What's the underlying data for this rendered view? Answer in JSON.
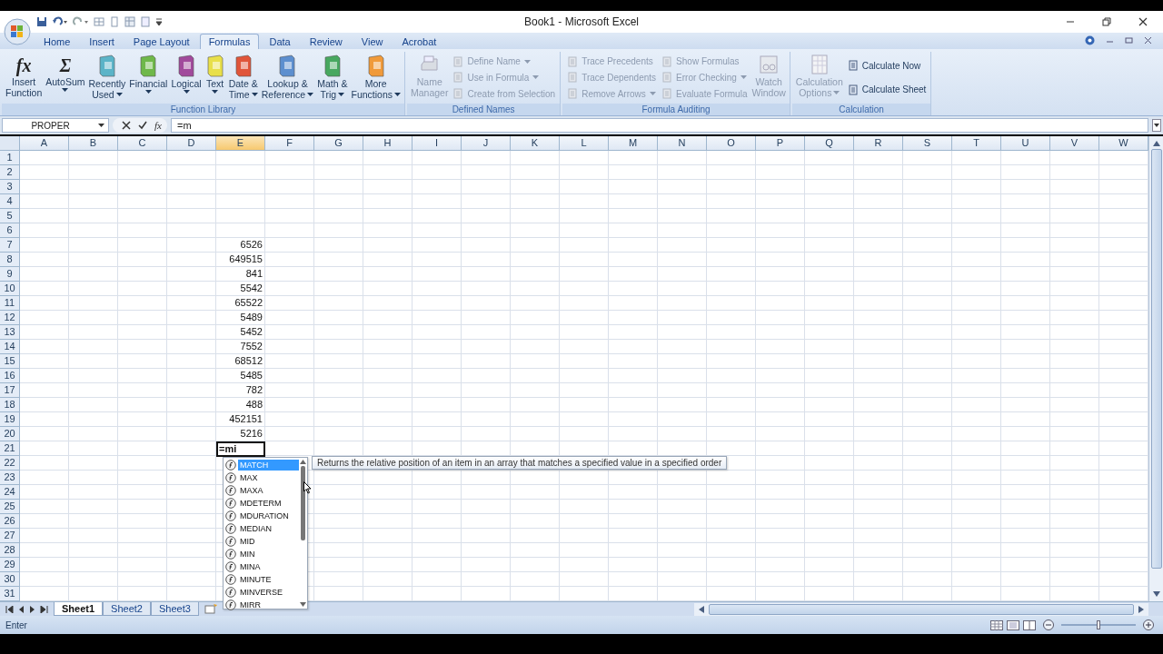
{
  "window": {
    "title": "Book1 - Microsoft Excel"
  },
  "tabs": [
    {
      "label": "Home",
      "selected": false
    },
    {
      "label": "Insert",
      "selected": false
    },
    {
      "label": "Page Layout",
      "selected": false
    },
    {
      "label": "Formulas",
      "selected": true
    },
    {
      "label": "Data",
      "selected": false
    },
    {
      "label": "Review",
      "selected": false
    },
    {
      "label": "View",
      "selected": false
    },
    {
      "label": "Acrobat",
      "selected": false
    }
  ],
  "ribbon": {
    "groups": [
      {
        "title": "Function Library",
        "items": [
          {
            "kind": "large",
            "label": [
              "Insert",
              "Function"
            ],
            "glyph": "fx",
            "dropdown": false,
            "disabled": false
          },
          {
            "kind": "large",
            "label": [
              "AutoSum"
            ],
            "glyph": "Σ",
            "dropdown": true,
            "disabled": false
          },
          {
            "kind": "large",
            "label": [
              "Recently",
              "Used"
            ],
            "color": "#5bb4c8",
            "dropdown": true,
            "disabled": false
          },
          {
            "kind": "large",
            "label": [
              "Financial"
            ],
            "color": "#6fb84a",
            "dropdown": true,
            "disabled": false
          },
          {
            "kind": "large",
            "label": [
              "Logical"
            ],
            "color": "#a14a9c",
            "dropdown": true,
            "disabled": false
          },
          {
            "kind": "large",
            "label": [
              "Text"
            ],
            "color": "#e8df4a",
            "dropdown": true,
            "disabled": false
          },
          {
            "kind": "large",
            "label": [
              "Date &",
              "Time"
            ],
            "color": "#e0553a",
            "dropdown": true,
            "disabled": false
          },
          {
            "kind": "large",
            "label": [
              "Lookup &",
              "Reference"
            ],
            "color": "#5d8fcf",
            "dropdown": true,
            "disabled": false
          },
          {
            "kind": "large",
            "label": [
              "Math &",
              "Trig"
            ],
            "color": "#48a860",
            "dropdown": true,
            "disabled": false
          },
          {
            "kind": "large",
            "label": [
              "More",
              "Functions"
            ],
            "color": "#f09a3a",
            "dropdown": true,
            "disabled": false
          }
        ]
      },
      {
        "title": "Defined Names",
        "items": [
          {
            "kind": "large",
            "label": [
              "Name",
              "Manager"
            ],
            "dropdown": false,
            "disabled": true
          },
          {
            "kind": "small",
            "label": "Define Name",
            "dropdown": true,
            "disabled": true
          },
          {
            "kind": "small",
            "label": "Use in Formula",
            "dropdown": true,
            "disabled": true
          },
          {
            "kind": "small",
            "label": "Create from Selection",
            "dropdown": false,
            "disabled": true
          }
        ]
      },
      {
        "title": "Formula Auditing",
        "items": [
          {
            "kind": "small",
            "label": "Trace Precedents",
            "dropdown": false,
            "disabled": true
          },
          {
            "kind": "small",
            "label": "Trace Dependents",
            "dropdown": false,
            "disabled": true
          },
          {
            "kind": "small",
            "label": "Remove Arrows",
            "dropdown": true,
            "disabled": true
          },
          {
            "kind": "small",
            "label": "Show Formulas",
            "dropdown": false,
            "disabled": true
          },
          {
            "kind": "small",
            "label": "Error Checking",
            "dropdown": true,
            "disabled": true
          },
          {
            "kind": "small",
            "label": "Evaluate Formula",
            "dropdown": false,
            "disabled": true
          },
          {
            "kind": "large",
            "label": [
              "Watch",
              "Window"
            ],
            "dropdown": false,
            "disabled": true
          }
        ]
      },
      {
        "title": "Calculation",
        "items": [
          {
            "kind": "large",
            "label": [
              "Calculation",
              "Options"
            ],
            "dropdown": true,
            "disabled": true
          },
          {
            "kind": "small",
            "label": "Calculate Now",
            "dropdown": false,
            "disabled": false
          },
          {
            "kind": "small",
            "label": "Calculate Sheet",
            "dropdown": false,
            "disabled": false
          }
        ]
      }
    ]
  },
  "formula_bar": {
    "name_box": "PROPER",
    "function_glyph": "fx",
    "formula": "=m"
  },
  "columns": [
    {
      "label": "A",
      "selected": false
    },
    {
      "label": "B",
      "selected": false
    },
    {
      "label": "C",
      "selected": false
    },
    {
      "label": "D",
      "selected": false
    },
    {
      "label": "E",
      "selected": true
    },
    {
      "label": "F",
      "selected": false
    },
    {
      "label": "G",
      "selected": false
    },
    {
      "label": "H",
      "selected": false
    },
    {
      "label": "I",
      "selected": false
    },
    {
      "label": "J",
      "selected": false
    },
    {
      "label": "K",
      "selected": false
    },
    {
      "label": "L",
      "selected": false
    },
    {
      "label": "M",
      "selected": false
    },
    {
      "label": "N",
      "selected": false
    },
    {
      "label": "O",
      "selected": false
    },
    {
      "label": "P",
      "selected": false
    },
    {
      "label": "Q",
      "selected": false
    },
    {
      "label": "R",
      "selected": false
    },
    {
      "label": "S",
      "selected": false
    },
    {
      "label": "T",
      "selected": false
    },
    {
      "label": "U",
      "selected": false
    },
    {
      "label": "V",
      "selected": false
    },
    {
      "label": "W",
      "selected": false
    }
  ],
  "rows": [
    {
      "label": "1"
    },
    {
      "label": "2"
    },
    {
      "label": "3"
    },
    {
      "label": "4"
    },
    {
      "label": "5"
    },
    {
      "label": "6"
    },
    {
      "label": "7",
      "value_e": "6526"
    },
    {
      "label": "8",
      "value_e": "649515"
    },
    {
      "label": "9",
      "value_e": "841"
    },
    {
      "label": "10",
      "value_e": "5542"
    },
    {
      "label": "11",
      "value_e": "65522"
    },
    {
      "label": "12",
      "value_e": "5489"
    },
    {
      "label": "13",
      "value_e": "5452"
    },
    {
      "label": "14",
      "value_e": "7552"
    },
    {
      "label": "15",
      "value_e": "68512"
    },
    {
      "label": "16",
      "value_e": "5485"
    },
    {
      "label": "17",
      "value_e": "782"
    },
    {
      "label": "18",
      "value_e": "488"
    },
    {
      "label": "19",
      "value_e": "452151"
    },
    {
      "label": "20",
      "value_e": "5216"
    },
    {
      "label": "21",
      "editing_e": "=mi"
    },
    {
      "label": "22"
    },
    {
      "label": "23"
    },
    {
      "label": "24"
    },
    {
      "label": "25"
    },
    {
      "label": "26"
    },
    {
      "label": "27"
    },
    {
      "label": "28"
    },
    {
      "label": "29"
    },
    {
      "label": "30"
    },
    {
      "label": "31"
    }
  ],
  "autocomplete": {
    "items": [
      {
        "label": "MATCH",
        "selected": true
      },
      {
        "label": "MAX",
        "selected": false
      },
      {
        "label": "MAXA",
        "selected": false
      },
      {
        "label": "MDETERM",
        "selected": false
      },
      {
        "label": "MDURATION",
        "selected": false
      },
      {
        "label": "MEDIAN",
        "selected": false
      },
      {
        "label": "MID",
        "selected": false
      },
      {
        "label": "MIN",
        "selected": false
      },
      {
        "label": "MINA",
        "selected": false
      },
      {
        "label": "MINUTE",
        "selected": false
      },
      {
        "label": "MINVERSE",
        "selected": false
      },
      {
        "label": "MIRR",
        "selected": false
      }
    ],
    "tooltip": "Returns the relative position of an item in an array that matches a specified value in a specified order"
  },
  "sheets": [
    {
      "label": "Sheet1",
      "selected": true
    },
    {
      "label": "Sheet2",
      "selected": false
    },
    {
      "label": "Sheet3",
      "selected": false
    }
  ],
  "status_bar": {
    "mode": "Enter",
    "zoom": {
      "level": 0.5
    }
  }
}
